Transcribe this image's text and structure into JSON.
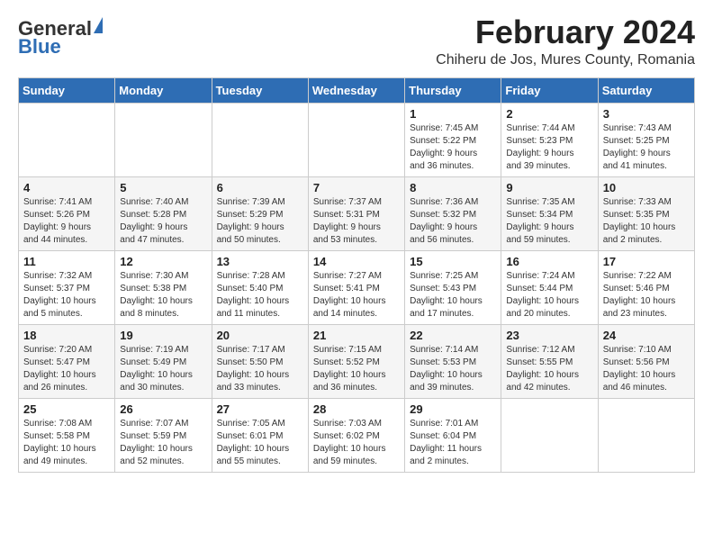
{
  "logo": {
    "general": "General",
    "blue": "Blue"
  },
  "header": {
    "month_year": "February 2024",
    "location": "Chiheru de Jos, Mures County, Romania"
  },
  "days_of_week": [
    "Sunday",
    "Monday",
    "Tuesday",
    "Wednesday",
    "Thursday",
    "Friday",
    "Saturday"
  ],
  "weeks": [
    [
      {
        "day": "",
        "info": ""
      },
      {
        "day": "",
        "info": ""
      },
      {
        "day": "",
        "info": ""
      },
      {
        "day": "",
        "info": ""
      },
      {
        "day": "1",
        "info": "Sunrise: 7:45 AM\nSunset: 5:22 PM\nDaylight: 9 hours\nand 36 minutes."
      },
      {
        "day": "2",
        "info": "Sunrise: 7:44 AM\nSunset: 5:23 PM\nDaylight: 9 hours\nand 39 minutes."
      },
      {
        "day": "3",
        "info": "Sunrise: 7:43 AM\nSunset: 5:25 PM\nDaylight: 9 hours\nand 41 minutes."
      }
    ],
    [
      {
        "day": "4",
        "info": "Sunrise: 7:41 AM\nSunset: 5:26 PM\nDaylight: 9 hours\nand 44 minutes."
      },
      {
        "day": "5",
        "info": "Sunrise: 7:40 AM\nSunset: 5:28 PM\nDaylight: 9 hours\nand 47 minutes."
      },
      {
        "day": "6",
        "info": "Sunrise: 7:39 AM\nSunset: 5:29 PM\nDaylight: 9 hours\nand 50 minutes."
      },
      {
        "day": "7",
        "info": "Sunrise: 7:37 AM\nSunset: 5:31 PM\nDaylight: 9 hours\nand 53 minutes."
      },
      {
        "day": "8",
        "info": "Sunrise: 7:36 AM\nSunset: 5:32 PM\nDaylight: 9 hours\nand 56 minutes."
      },
      {
        "day": "9",
        "info": "Sunrise: 7:35 AM\nSunset: 5:34 PM\nDaylight: 9 hours\nand 59 minutes."
      },
      {
        "day": "10",
        "info": "Sunrise: 7:33 AM\nSunset: 5:35 PM\nDaylight: 10 hours\nand 2 minutes."
      }
    ],
    [
      {
        "day": "11",
        "info": "Sunrise: 7:32 AM\nSunset: 5:37 PM\nDaylight: 10 hours\nand 5 minutes."
      },
      {
        "day": "12",
        "info": "Sunrise: 7:30 AM\nSunset: 5:38 PM\nDaylight: 10 hours\nand 8 minutes."
      },
      {
        "day": "13",
        "info": "Sunrise: 7:28 AM\nSunset: 5:40 PM\nDaylight: 10 hours\nand 11 minutes."
      },
      {
        "day": "14",
        "info": "Sunrise: 7:27 AM\nSunset: 5:41 PM\nDaylight: 10 hours\nand 14 minutes."
      },
      {
        "day": "15",
        "info": "Sunrise: 7:25 AM\nSunset: 5:43 PM\nDaylight: 10 hours\nand 17 minutes."
      },
      {
        "day": "16",
        "info": "Sunrise: 7:24 AM\nSunset: 5:44 PM\nDaylight: 10 hours\nand 20 minutes."
      },
      {
        "day": "17",
        "info": "Sunrise: 7:22 AM\nSunset: 5:46 PM\nDaylight: 10 hours\nand 23 minutes."
      }
    ],
    [
      {
        "day": "18",
        "info": "Sunrise: 7:20 AM\nSunset: 5:47 PM\nDaylight: 10 hours\nand 26 minutes."
      },
      {
        "day": "19",
        "info": "Sunrise: 7:19 AM\nSunset: 5:49 PM\nDaylight: 10 hours\nand 30 minutes."
      },
      {
        "day": "20",
        "info": "Sunrise: 7:17 AM\nSunset: 5:50 PM\nDaylight: 10 hours\nand 33 minutes."
      },
      {
        "day": "21",
        "info": "Sunrise: 7:15 AM\nSunset: 5:52 PM\nDaylight: 10 hours\nand 36 minutes."
      },
      {
        "day": "22",
        "info": "Sunrise: 7:14 AM\nSunset: 5:53 PM\nDaylight: 10 hours\nand 39 minutes."
      },
      {
        "day": "23",
        "info": "Sunrise: 7:12 AM\nSunset: 5:55 PM\nDaylight: 10 hours\nand 42 minutes."
      },
      {
        "day": "24",
        "info": "Sunrise: 7:10 AM\nSunset: 5:56 PM\nDaylight: 10 hours\nand 46 minutes."
      }
    ],
    [
      {
        "day": "25",
        "info": "Sunrise: 7:08 AM\nSunset: 5:58 PM\nDaylight: 10 hours\nand 49 minutes."
      },
      {
        "day": "26",
        "info": "Sunrise: 7:07 AM\nSunset: 5:59 PM\nDaylight: 10 hours\nand 52 minutes."
      },
      {
        "day": "27",
        "info": "Sunrise: 7:05 AM\nSunset: 6:01 PM\nDaylight: 10 hours\nand 55 minutes."
      },
      {
        "day": "28",
        "info": "Sunrise: 7:03 AM\nSunset: 6:02 PM\nDaylight: 10 hours\nand 59 minutes."
      },
      {
        "day": "29",
        "info": "Sunrise: 7:01 AM\nSunset: 6:04 PM\nDaylight: 11 hours\nand 2 minutes."
      },
      {
        "day": "",
        "info": ""
      },
      {
        "day": "",
        "info": ""
      }
    ]
  ]
}
